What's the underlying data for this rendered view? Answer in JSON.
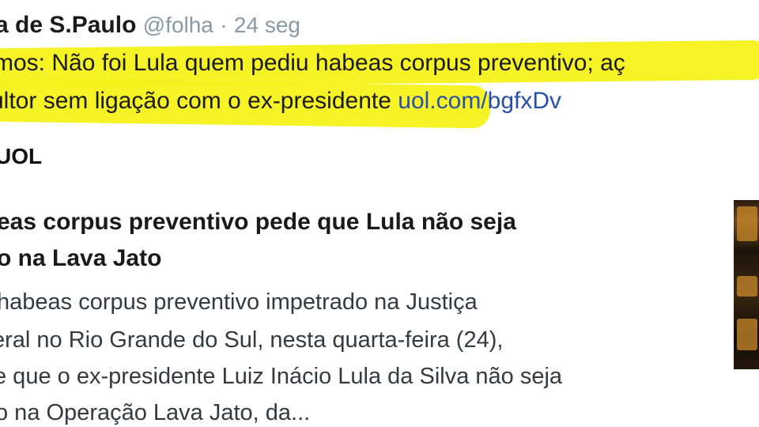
{
  "tweet": {
    "author_name": "a de S.Paulo",
    "handle": "@folha",
    "separator": "·",
    "time": "24 seg",
    "text_line_1": "mos: Não foi Lula quem pediu habeas corpus preventivo; aç",
    "text_line_2": "ultor sem ligação com o ex-presidente",
    "link_text": "uol.com/bgfxDv",
    "highlight_color": "#f4f11a",
    "link_color": "#2850a8"
  },
  "card": {
    "source": "UOL",
    "title_line_1": "eas corpus preventivo pede que Lula não seja",
    "title_line_2": "o na Lava Jato",
    "description_lines": [
      "habeas corpus preventivo impetrado na Justiça",
      "eral no Rio Grande do Sul, nesta quarta-feira (24),",
      "e que o ex-presidente Luiz Inácio Lula da Silva não seja",
      "o na Operação Lava Jato, da..."
    ]
  }
}
